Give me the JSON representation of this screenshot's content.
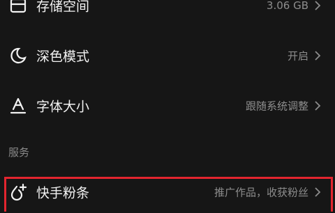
{
  "settings": {
    "storage": {
      "label": "存储空间",
      "value": "3.06 GB",
      "icon": "storage-box-icon"
    },
    "dark_mode": {
      "label": "深色模式",
      "value": "开启",
      "icon": "moon-icon"
    },
    "font_size": {
      "label": "字体大小",
      "value": "跟随系统调整",
      "icon": "text-size-icon"
    }
  },
  "services": {
    "header": "服务",
    "kuaishou_fans": {
      "label": "快手粉条",
      "value": "推广作品，收获粉丝",
      "icon": "flame-plus-icon"
    }
  },
  "colors": {
    "background": "#161616",
    "highlight": "#e3252f",
    "secondary_text": "#8d8d8d"
  }
}
